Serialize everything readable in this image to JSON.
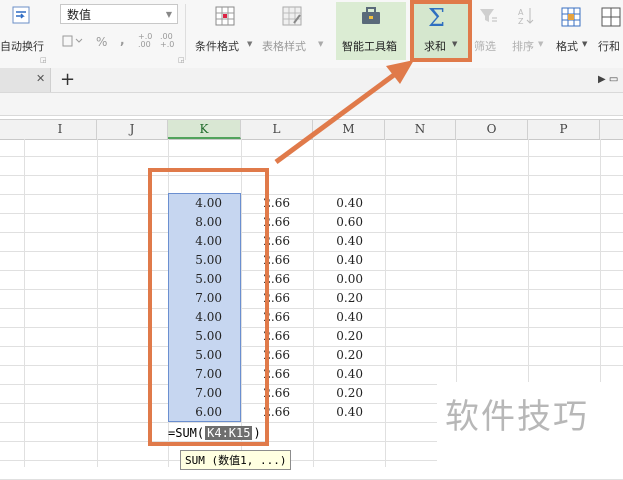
{
  "ribbon": {
    "wrap_text": "自动换行",
    "number_format": "数值",
    "percent": "%",
    "comma": ",",
    "inc_decimal": "+.0\n.00",
    "dec_decimal": ".00\n+.0",
    "conditional_format": "条件格式",
    "table_style": "表格样式",
    "smart_tools": "智能工具箱",
    "sum": "求和",
    "filter": "筛选",
    "sort": "排序",
    "format": "格式",
    "row_col": "行和"
  },
  "tabs": {
    "add": "+"
  },
  "columns": [
    "I",
    "J",
    "K",
    "L",
    "M",
    "N",
    "O",
    "P"
  ],
  "selected_column": "K",
  "rows": [
    {
      "k": "4.00",
      "l": "2.66",
      "m": "0.40"
    },
    {
      "k": "8.00",
      "l": "2.66",
      "m": "0.60"
    },
    {
      "k": "4.00",
      "l": "2.66",
      "m": "0.40"
    },
    {
      "k": "5.00",
      "l": "2.66",
      "m": "0.40"
    },
    {
      "k": "5.00",
      "l": "2.66",
      "m": "0.00"
    },
    {
      "k": "7.00",
      "l": "2.66",
      "m": "0.20"
    },
    {
      "k": "4.00",
      "l": "2.66",
      "m": "0.40"
    },
    {
      "k": "5.00",
      "l": "2.66",
      "m": "0.20"
    },
    {
      "k": "5.00",
      "l": "2.66",
      "m": "0.20"
    },
    {
      "k": "7.00",
      "l": "2.66",
      "m": "0.40"
    },
    {
      "k": "7.00",
      "l": "2.66",
      "m": "0.20"
    },
    {
      "k": "6.00",
      "l": "2.66",
      "m": "0.40"
    }
  ],
  "formula": {
    "prefix": "=SUM(",
    "range": "K4:K15",
    "suffix": ")"
  },
  "tooltip": "SUM (数值1, ...)",
  "watermark": "软件技巧",
  "colors": {
    "annotation": "#e07a4a",
    "selection": "#c6d6f0",
    "smart_bg": "#dbecd3",
    "sum_icon": "#2f6fc0"
  }
}
